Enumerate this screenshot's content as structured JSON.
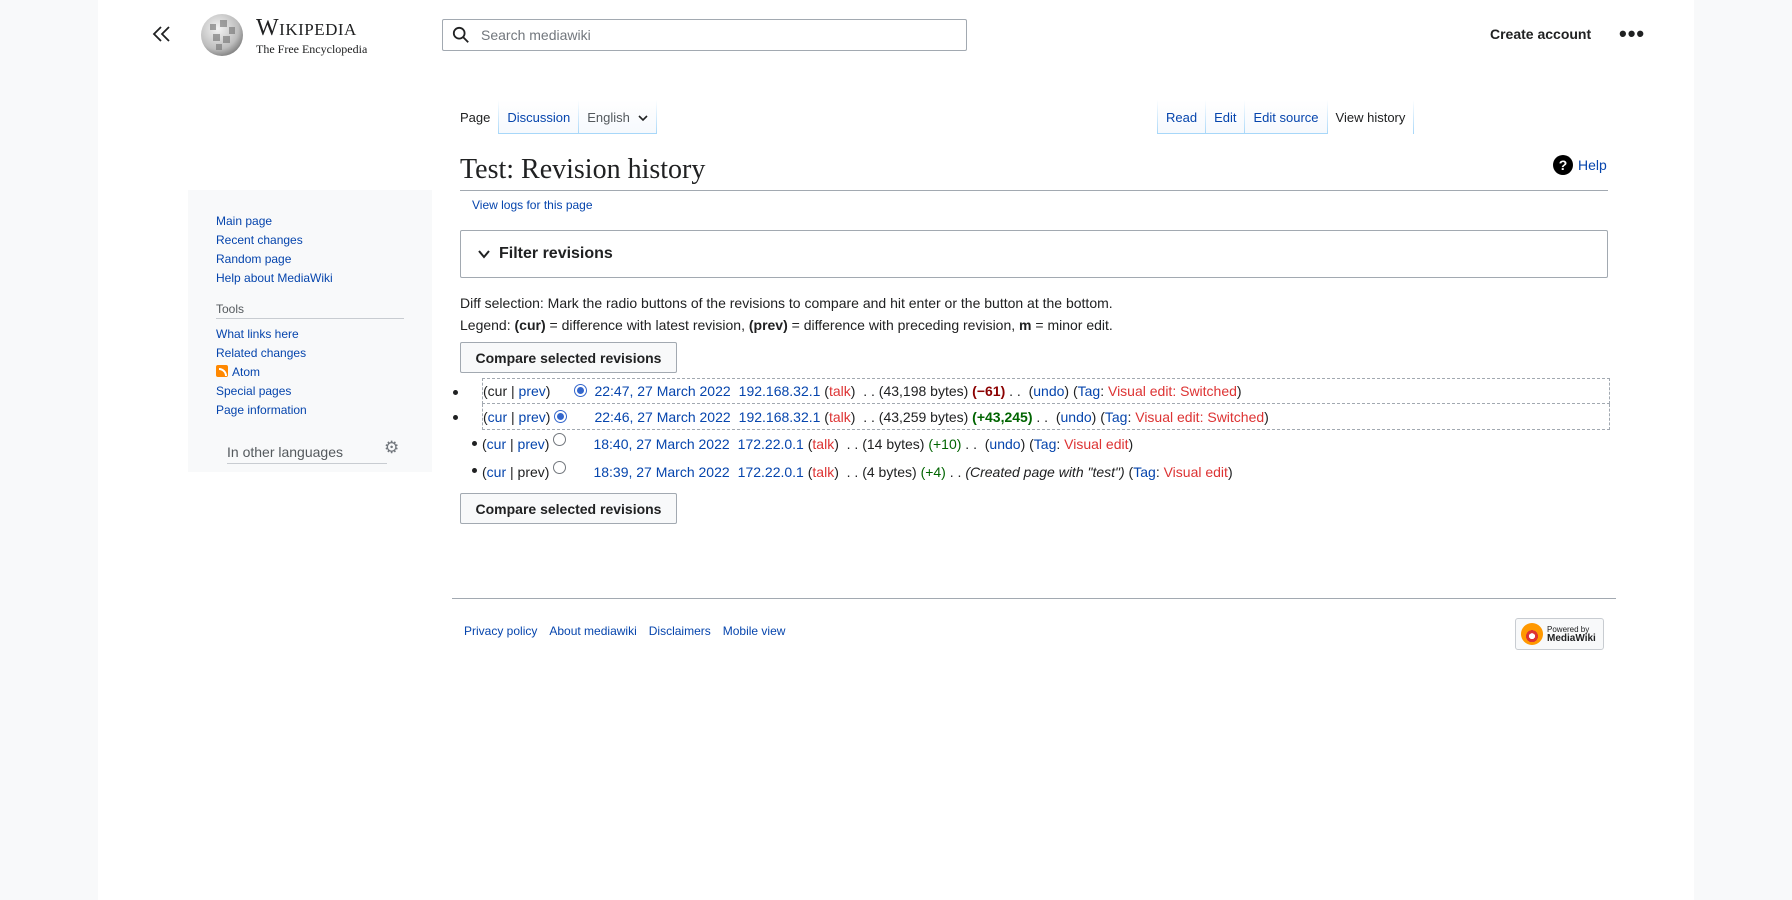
{
  "header": {
    "wordmark_title": "Wikipedia",
    "wordmark_tagline": "The Free Encyclopedia",
    "search_placeholder": "Search mediawiki",
    "create_account": "Create account",
    "more": "•••"
  },
  "tabs": {
    "left": [
      {
        "label": "Page",
        "selected": true
      },
      {
        "label": "Discussion",
        "selected": false
      }
    ],
    "language": "English",
    "right": [
      {
        "label": "Read",
        "selected": false
      },
      {
        "label": "Edit",
        "selected": false
      },
      {
        "label": "Edit source",
        "selected": false
      },
      {
        "label": "View history",
        "selected": true
      }
    ]
  },
  "main": {
    "title": "Test: Revision history",
    "help": "Help",
    "view_logs": "View logs for this page",
    "filter_label": "Filter revisions",
    "diff_selection": "Diff selection: Mark the radio buttons of the revisions to compare and hit enter or the button at the bottom.",
    "legend_prefix": "Legend:",
    "legend_cur": "(cur)",
    "legend_cur_text": "= difference with latest revision,",
    "legend_prev": "(prev)",
    "legend_prev_text": "= difference with preceding revision,",
    "legend_m": "m",
    "legend_m_text": "= minor edit.",
    "compare_button": "Compare selected revisions"
  },
  "revisions": [
    {
      "cur": "cur",
      "prev": "prev",
      "cur_link": false,
      "prev_link": true,
      "date": "22:47, 27 March 2022",
      "user": "192.168.32.1",
      "talk": "talk",
      "bytes": "(43,198 bytes)",
      "diff": "(−61)",
      "undo": "undo",
      "tag_prefix": "Tag",
      "tag": "Visual edit: Switched",
      "summary": ""
    },
    {
      "cur": "cur",
      "prev": "prev",
      "cur_link": true,
      "prev_link": true,
      "date": "22:46, 27 March 2022",
      "user": "192.168.32.1",
      "talk": "talk",
      "bytes": "(43,259 bytes)",
      "diff": "(+43,245)",
      "undo": "undo",
      "tag_prefix": "Tag",
      "tag": "Visual edit: Switched",
      "summary": ""
    },
    {
      "cur": "cur",
      "prev": "prev",
      "cur_link": true,
      "prev_link": true,
      "date": "18:40, 27 March 2022",
      "user": "172.22.0.1",
      "talk": "talk",
      "bytes": "(14 bytes)",
      "diff": "(+10)",
      "undo": "undo",
      "tag_prefix": "Tag",
      "tag": "Visual edit",
      "summary": ""
    },
    {
      "cur": "cur",
      "prev": "prev",
      "cur_link": true,
      "prev_link": false,
      "date": "18:39, 27 March 2022",
      "user": "172.22.0.1",
      "talk": "talk",
      "bytes": "(4 bytes)",
      "diff": "(+4)",
      "undo": "",
      "tag_prefix": "Tag",
      "tag": "Visual edit",
      "summary": "(Created page with \"test\")"
    }
  ],
  "sidebar": {
    "main_items": [
      "Main page",
      "Recent changes",
      "Random page",
      "Help about MediaWiki"
    ],
    "tools_heading": "Tools",
    "tools_items": [
      "What links here",
      "Related changes",
      "Atom",
      "Special pages",
      "Page information"
    ],
    "languages_heading": "In other languages"
  },
  "footer": {
    "links": [
      "Privacy policy",
      "About mediawiki",
      "Disclaimers",
      "Mobile view"
    ],
    "powered_line1": "Powered by",
    "powered_line2": "MediaWiki"
  },
  "colors": {
    "link": "#0645ad",
    "red_link": "#d33",
    "negative_diff": "#8b0000",
    "positive_diff": "#006400"
  }
}
